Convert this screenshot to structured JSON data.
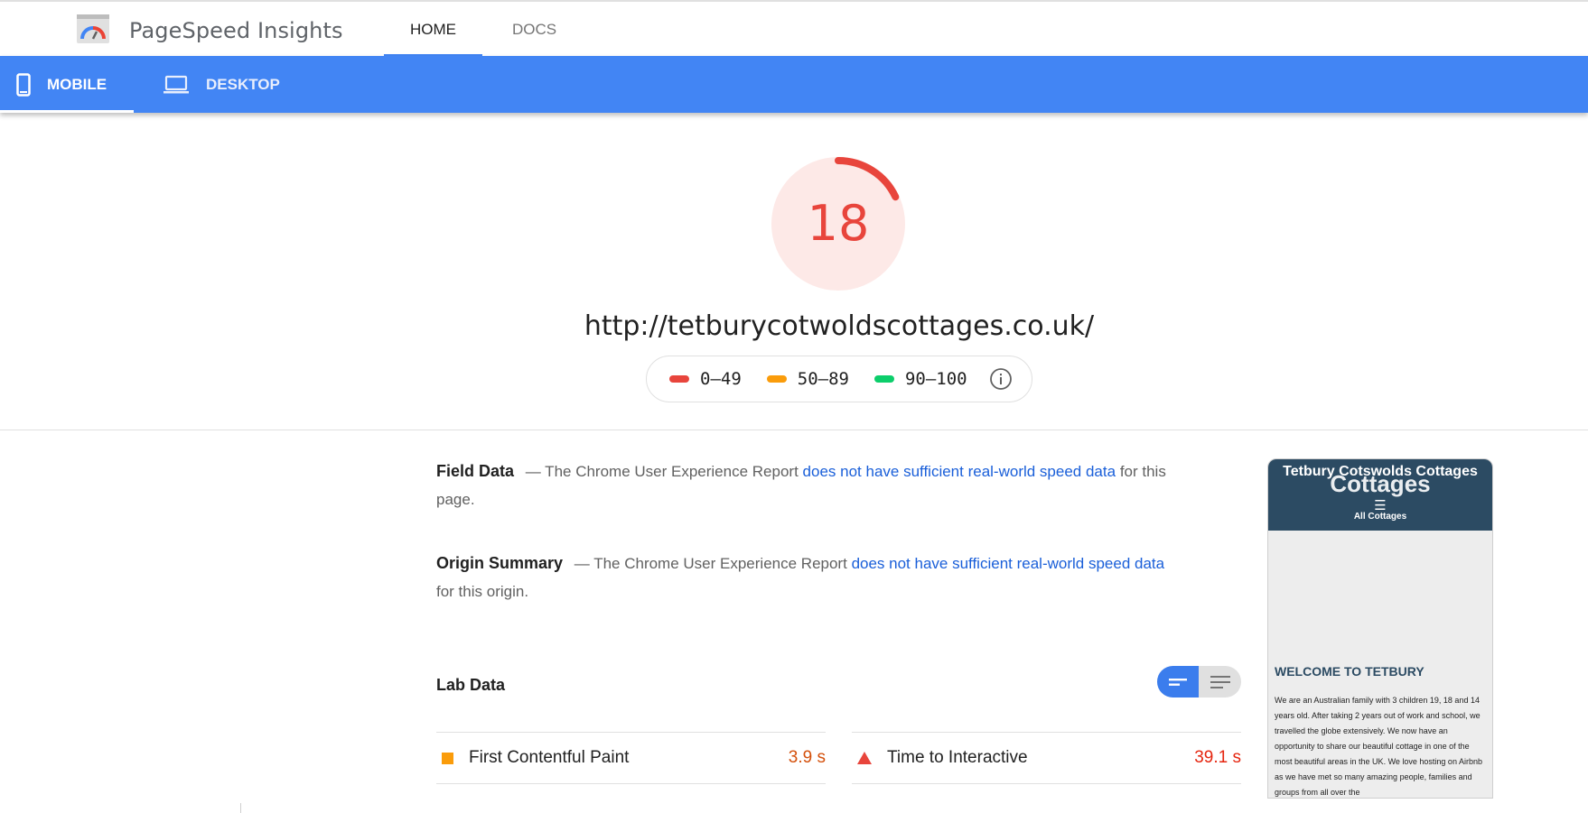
{
  "header": {
    "brand": "PageSpeed Insights",
    "tabs": {
      "home": "HOME",
      "docs": "DOCS"
    }
  },
  "devices": {
    "mobile": "MOBILE",
    "desktop": "DESKTOP"
  },
  "score": {
    "value": "18",
    "fraction": 0.18,
    "color": "#e8453c",
    "url": "http://tetburycotwoldscottages.co.uk/"
  },
  "legend": {
    "poor": "0–49",
    "average": "50–89",
    "good": "90–100",
    "colors": {
      "poor": "#e8453c",
      "average": "#fa9c0b",
      "good": "#0cce6b"
    }
  },
  "field_data": {
    "label": "Field Data",
    "prefix": "— The Chrome User Experience Report",
    "link": "does not have sufficient real-world speed data",
    "suffix": "for this page."
  },
  "origin_summary": {
    "label": "Origin Summary",
    "prefix": "— The Chrome User Experience Report",
    "link": "does not have sufficient real-world speed data",
    "suffix": "for this origin."
  },
  "lab_data": {
    "title": "Lab Data",
    "metrics": [
      {
        "name": "First Contentful Paint",
        "value": "3.9 s",
        "status": "average"
      },
      {
        "name": "Time to Interactive",
        "value": "39.1 s",
        "status": "poor"
      }
    ]
  },
  "preview": {
    "site_title": "Tetbury Cotswolds Cottages",
    "overlay_title": "Cottages",
    "menu_label": "All Cottages",
    "welcome": "WELCOME TO TETBURY",
    "body": "We are an Australian family with 3 children 19, 18 and 14 years old. After taking 2 years out of work and school, we travelled the globe extensively. We now have an opportunity to share our beautiful cottage in one of the most beautiful areas in the UK. We love hosting on Airbnb as we have met so many amazing people, families and groups from all over the"
  }
}
